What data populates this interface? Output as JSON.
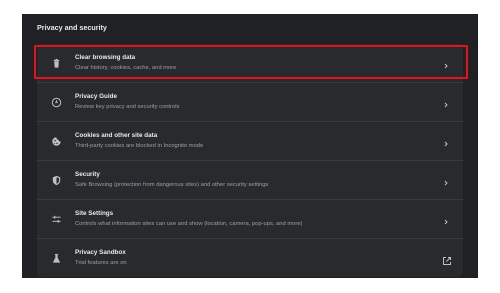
{
  "section": {
    "title": "Privacy and security"
  },
  "items": [
    {
      "title": "Clear browsing data",
      "subtitle": "Clear history, cookies, cache, and more",
      "icon": "trash-icon"
    },
    {
      "title": "Privacy Guide",
      "subtitle": "Review key privacy and security controls",
      "icon": "privacy-guide-icon"
    },
    {
      "title": "Cookies and other site data",
      "subtitle": "Third-party cookies are blocked in Incognito mode",
      "icon": "cookie-icon"
    },
    {
      "title": "Security",
      "subtitle": "Safe Browsing (protection from dangerous sites) and other security settings",
      "icon": "shield-icon"
    },
    {
      "title": "Site Settings",
      "subtitle": "Controls what information sites can use and show (location, camera, pop-ups, and more)",
      "icon": "sliders-icon"
    },
    {
      "title": "Privacy Sandbox",
      "subtitle": "Trial features are on",
      "icon": "flask-icon"
    }
  ],
  "colors": {
    "background": "#202124",
    "card": "#292a2d",
    "title_text": "#e8eaed",
    "subtitle_text": "#9aa0a6",
    "highlight": "#e0141e"
  }
}
